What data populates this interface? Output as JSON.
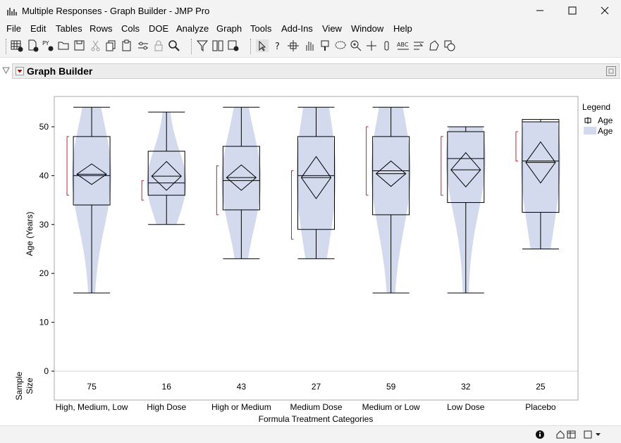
{
  "window": {
    "title": "Multiple Responses - Graph Builder - JMP Pro"
  },
  "menu": [
    "File",
    "Edit",
    "Tables",
    "Rows",
    "Cols",
    "DOE",
    "Analyze",
    "Graph",
    "Tools",
    "Add-Ins",
    "View",
    "Window",
    "Help"
  ],
  "toolbar": {
    "icons": [
      "new-data-table-icon",
      "new-data-view-icon",
      "new-script-icon",
      "open-folder-icon",
      "save-icon",
      "cut-icon",
      "copy-icon",
      "paste-icon",
      "adjust-icon",
      "lock-icon",
      "search-icon",
      "filter-icon",
      "join-icon",
      "subset-icon",
      "arrow-pointer-icon",
      "help-question-icon",
      "crosshair-icon",
      "hand-icon",
      "brush-icon",
      "lasso-icon",
      "zoom-icon",
      "plus-icon",
      "marker-icon",
      "spell-check-icon",
      "wrap-icon",
      "shape-icon",
      "shapes-icon"
    ]
  },
  "graph_builder": {
    "title": "Graph Builder"
  },
  "chart_data": {
    "type": "box+violin",
    "xlabel": "Formula Treatment Categories",
    "ylabel": "Age (Years)",
    "ylim": [
      0,
      57
    ],
    "yticks": [
      0,
      10,
      20,
      30,
      40,
      50
    ],
    "sample_size_label": "Sample Size",
    "legend": {
      "title": "Legend",
      "entries": [
        {
          "label": "Age",
          "kind": "box"
        },
        {
          "label": "Age",
          "kind": "violin"
        }
      ],
      "placement": "right"
    },
    "colors": {
      "violin": "#d3daee",
      "box_line": "#000000",
      "bracket": "#c0243a"
    },
    "categories": [
      {
        "name": "High, Medium, Low",
        "n": "75",
        "min": 16,
        "q1": 34,
        "median": 40,
        "q3": 48,
        "max": 54,
        "mean": 40.3,
        "ci": [
          38.2,
          42.4
        ],
        "shortest_half": [
          36,
          48
        ]
      },
      {
        "name": "High Dose",
        "n": "16",
        "min": 30,
        "q1": 36,
        "median": 38.5,
        "q3": 45,
        "max": 53,
        "mean": 39.9,
        "ci": [
          37.0,
          42.9
        ],
        "shortest_half": [
          35,
          39
        ]
      },
      {
        "name": "High or Medium",
        "n": "43",
        "min": 23,
        "q1": 33,
        "median": 39,
        "q3": 46,
        "max": 54,
        "mean": 39.6,
        "ci": [
          37.0,
          42.2
        ],
        "shortest_half": [
          32,
          42
        ]
      },
      {
        "name": "Medium Dose",
        "n": "27",
        "min": 23,
        "q1": 29,
        "median": 40,
        "q3": 48,
        "max": 54,
        "mean": 39.6,
        "ci": [
          35.3,
          43.9
        ],
        "shortest_half": [
          27,
          41
        ]
      },
      {
        "name": "Medium or Low",
        "n": "59",
        "min": 16,
        "q1": 32,
        "median": 41,
        "q3": 48,
        "max": 54,
        "mean": 40.4,
        "ci": [
          37.8,
          43.0
        ],
        "shortest_half": [
          36,
          50
        ]
      },
      {
        "name": "Low Dose",
        "n": "32",
        "min": 16,
        "q1": 34.5,
        "median": 43.5,
        "q3": 49,
        "max": 50,
        "mean": 41.2,
        "ci": [
          37.7,
          44.7
        ],
        "shortest_half": [
          36,
          48
        ]
      },
      {
        "name": "Placebo",
        "n": "25",
        "min": 25,
        "q1": 32.5,
        "median": 43,
        "q3": 51.5,
        "max": 51,
        "mean": 42.7,
        "ci": [
          38.5,
          46.9
        ],
        "shortest_half": [
          43,
          49
        ]
      }
    ]
  }
}
